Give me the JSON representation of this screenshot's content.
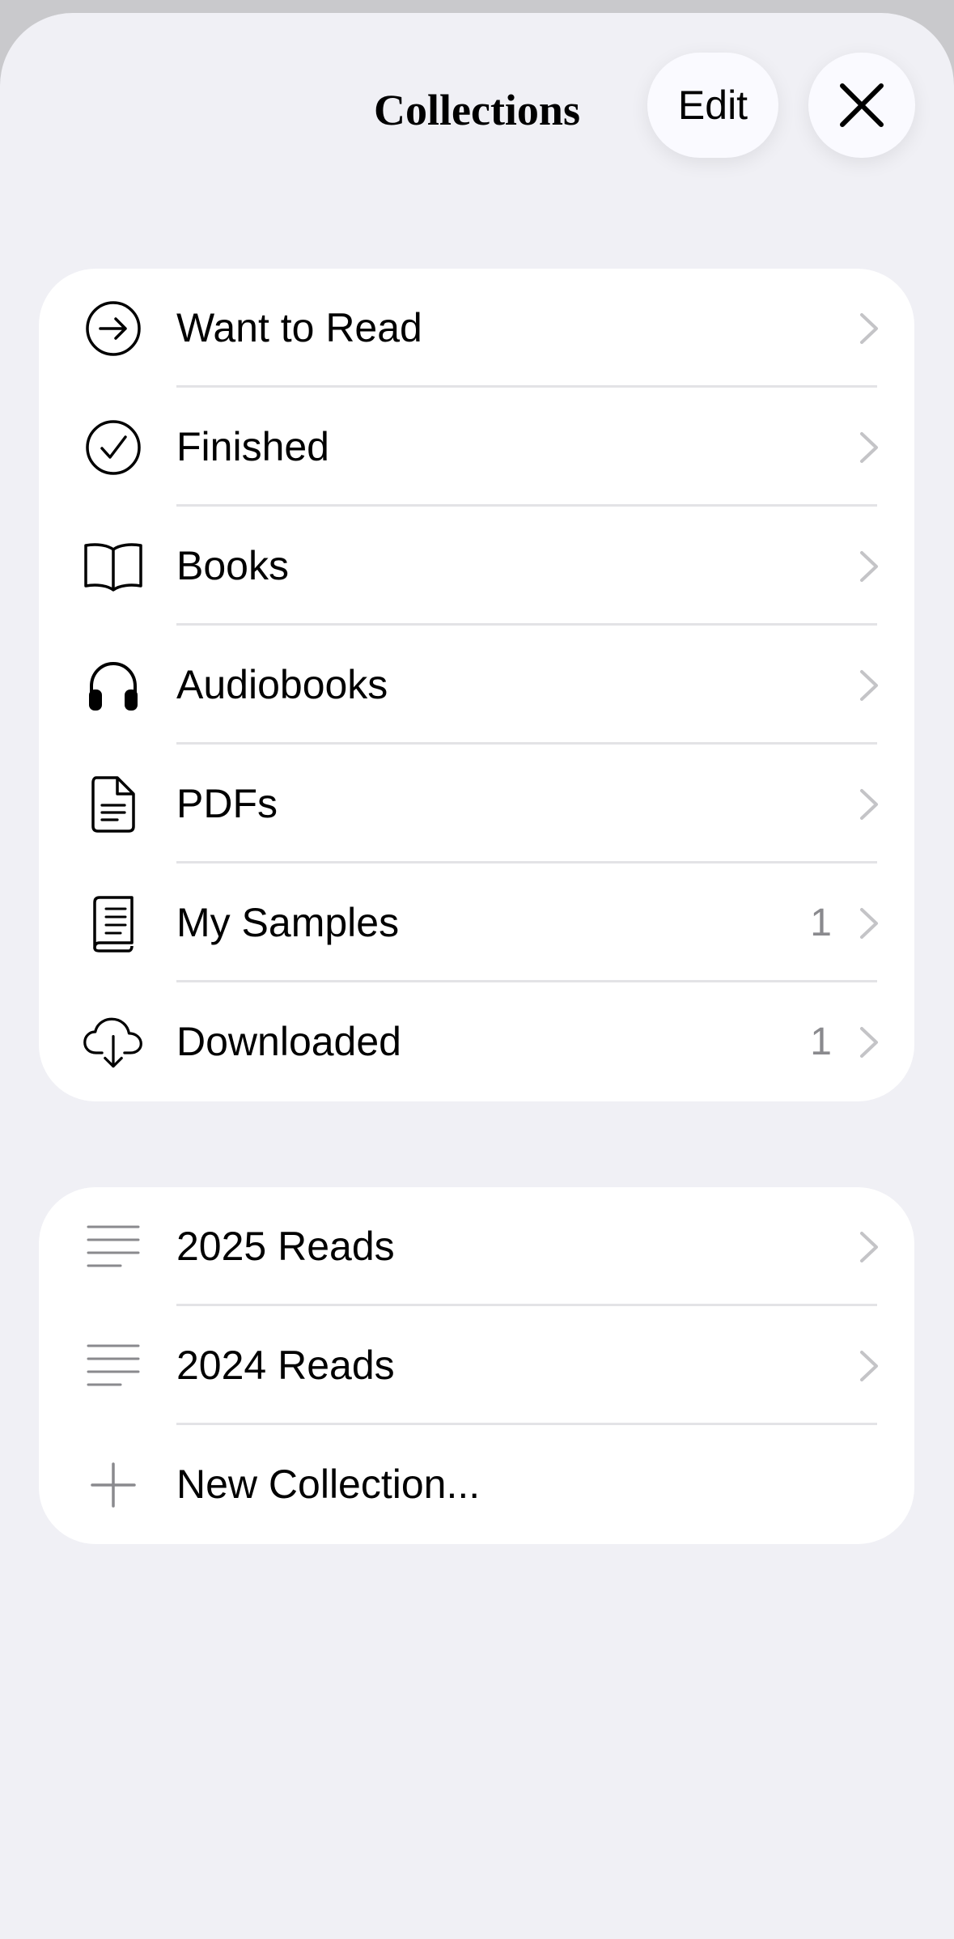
{
  "header": {
    "title": "Collections",
    "edit_label": "Edit",
    "close_icon": "close-icon"
  },
  "library_group": {
    "items": [
      {
        "label": "Want to Read",
        "icon": "arrow-right-circle-icon",
        "count": ""
      },
      {
        "label": "Finished",
        "icon": "checkmark-circle-icon",
        "count": ""
      },
      {
        "label": "Books",
        "icon": "open-book-icon",
        "count": ""
      },
      {
        "label": "Audiobooks",
        "icon": "headphones-icon",
        "count": ""
      },
      {
        "label": "PDFs",
        "icon": "document-icon",
        "count": ""
      },
      {
        "label": "My Samples",
        "icon": "samples-book-icon",
        "count": "1"
      },
      {
        "label": "Downloaded",
        "icon": "cloud-download-icon",
        "count": "1"
      }
    ]
  },
  "custom_group": {
    "items": [
      {
        "label": "2025 Reads",
        "icon": "list-lines-icon"
      },
      {
        "label": "2024 Reads",
        "icon": "list-lines-icon"
      },
      {
        "label": "New Collection...",
        "icon": "plus-icon"
      }
    ]
  },
  "colors": {
    "background": "#f0f0f5",
    "card": "#ffffff",
    "secondary_text": "#8a8a8e",
    "chevron": "#c4c4c7"
  }
}
